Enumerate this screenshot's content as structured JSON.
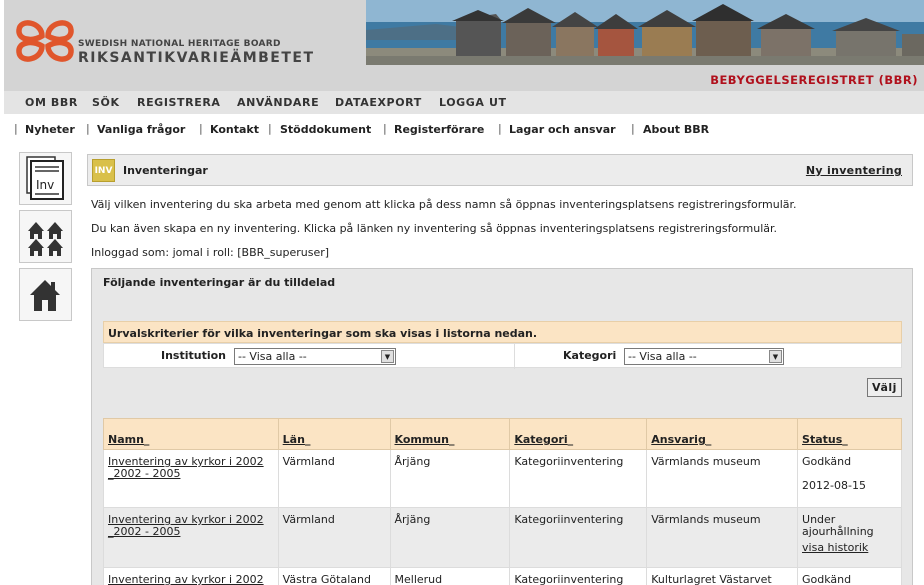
{
  "header": {
    "logo_line1": "SWEDISH NATIONAL HERITAGE BOARD",
    "logo_line2": "RIKSANTIKVARIEÄMBETET",
    "site_name": "BEBYGGELSEREGISTRET (BBR)",
    "accent_color": "#b0101c",
    "logo_color": "#e0562c"
  },
  "mainnav": {
    "items": [
      "OM BBR",
      "SÖK",
      "REGISTRERA",
      "ANVÄNDARE",
      "DATAEXPORT",
      "LOGGA UT"
    ]
  },
  "subnav": {
    "items": [
      "Nyheter",
      "Vanliga frågor",
      "Kontakt",
      "Stöddokument",
      "Registerförare",
      "Lagar och ansvar",
      "About BBR"
    ]
  },
  "sidebar": {
    "buttons": [
      {
        "icon": "inventory-document-icon",
        "label": "Inv"
      },
      {
        "icon": "multiple-houses-icon"
      },
      {
        "icon": "house-icon"
      }
    ]
  },
  "inventory_header": {
    "icon_label": "INV",
    "title": "Inventeringar",
    "new_link": "Ny inventering"
  },
  "info": {
    "line1": "Välj vilken inventering du ska arbeta med genom att klicka på dess namn så öppnas inventeringsplatsens registreringsformulär.",
    "line2": "Du kan även skapa en ny inventering. Klicka på länken ny inventering så öppnas inventeringsplatsens registreringsformulär.",
    "line3": "Inloggad som: jomal i roll: [BBR_superuser]"
  },
  "assigned": {
    "title": "Följande inventeringar är du tilldelad",
    "criteria_title": "Urvalskriterier för vilka inventeringar som ska visas i listorna nedan.",
    "institution_label": "Institution",
    "institution_value": "-- Visa alla --",
    "kategori_label": "Kategori",
    "kategori_value": "-- Visa alla --",
    "valj_label": "Välj"
  },
  "table": {
    "headers": [
      "Namn",
      "Län",
      "Kommun",
      "Kategori",
      "Ansvarig",
      "Status"
    ],
    "rows": [
      {
        "name": "Inventering av kyrkor i 2002 _2002 - 2005",
        "lan": "Värmland",
        "kommun": "Årjäng",
        "kategori": "Kategoriinventering",
        "ansvarig": "Värmlands museum",
        "status": "Godkänd",
        "date": "2012-08-15",
        "history": ""
      },
      {
        "name": "Inventering av kyrkor i 2002 _2002 - 2005",
        "lan": "Värmland",
        "kommun": "Årjäng",
        "kategori": "Kategoriinventering",
        "ansvarig": "Värmlands museum",
        "status": "Under ajourhållning",
        "date": "",
        "history": "visa historik"
      },
      {
        "name": "Inventering av kyrkor i 2002",
        "lan": "Västra Götaland",
        "kommun": "Mellerud",
        "kategori": "Kategoriinventering",
        "ansvarig": "Kulturlagret Västarvet",
        "status": "Godkänd",
        "date": "",
        "history": ""
      }
    ]
  }
}
